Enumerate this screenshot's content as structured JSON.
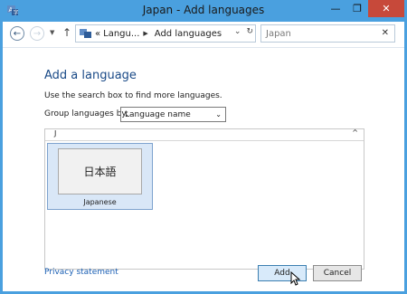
{
  "window": {
    "title": "Japan - Add languages"
  },
  "titlebar": {
    "minimize": "—",
    "maximize": "❐",
    "close": "✕"
  },
  "nav": {
    "breadcrumb_prefix": "«",
    "crumb1": "Langu...",
    "crumb2": "Add languages",
    "search_placeholder": "Japan",
    "search_clear": "✕",
    "back": "←",
    "forward": "→",
    "up": "↑",
    "refresh": "↻"
  },
  "main": {
    "heading": "Add a language",
    "description": "Use the search box to find more languages.",
    "group_label": "Group languages by:",
    "group_value": "Language name",
    "group_letter": "J",
    "languages": [
      {
        "native": "日本語",
        "name": "Japanese",
        "selected": true
      }
    ]
  },
  "footer": {
    "privacy": "Privacy statement",
    "add": "Add",
    "cancel": "Cancel"
  },
  "colors": {
    "accent": "#4aa0df",
    "link": "#1a5fb4",
    "selection": "#d9e7f7",
    "close": "#c7493a"
  }
}
